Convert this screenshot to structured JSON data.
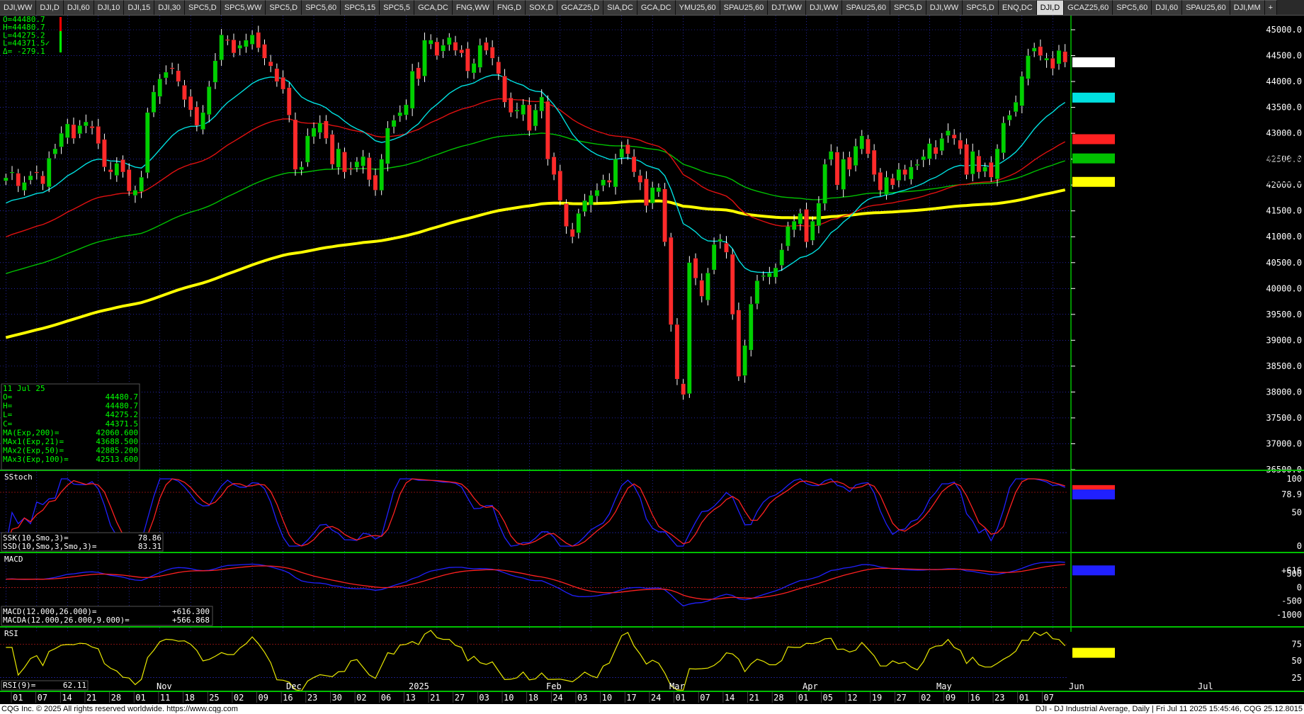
{
  "tabs": [
    "DJI,WW",
    "DJI,D",
    "DJI,60",
    "DJI,10",
    "DJI,15",
    "DJI,30",
    "SPC5,D",
    "SPC5,WW",
    "SPC5,D",
    "SPC5,60",
    "SPC5,15",
    "SPC5,5",
    "GCA,DC",
    "FNG,WW",
    "FNG,D",
    "SOX,D",
    "GCAZ25,D",
    "SIA,DC",
    "GCA,DC",
    "YMU25,60",
    "SPAU25,60",
    "DJT,WW",
    "DJI,WW",
    "SPAU25,60",
    "SPC5,D",
    "DJI,WW",
    "SPC5,D",
    "ENQ,DC",
    "DJI,D",
    "GCAZ25,60",
    "SPC5,60",
    "DJI,60",
    "SPAU25,60",
    "DJI,MM",
    "+"
  ],
  "active_tab_index": 28,
  "ohlc_top": {
    "o": "O=44480.7",
    "h": "H=44480.7",
    "l": "L=44275.2",
    "c": "L=44371.5✓",
    "d": "Δ= -279.1"
  },
  "cursor_box": {
    "date": "11 Jul 25",
    "rows": [
      {
        "label": "O=",
        "value": "44480.7"
      },
      {
        "label": "H=",
        "value": "44480.7"
      },
      {
        "label": "L=",
        "value": "44275.2"
      },
      {
        "label": "C=",
        "value": "44371.5"
      },
      {
        "label": "MA(Exp,200)=",
        "value": "42060.600"
      },
      {
        "label": "MAx1(Exp,21)=",
        "value": "43688.500"
      },
      {
        "label": "MAx2(Exp,50)=",
        "value": "42885.200"
      },
      {
        "label": "MAx3(Exp,100)=",
        "value": "42513.600"
      }
    ]
  },
  "price_axis": {
    "labels": [
      "45000.0",
      "44500.0",
      "44000.0",
      "43500.0",
      "43000.0",
      "42500.0",
      "42000.0",
      "41500.0",
      "41000.0",
      "40500.0",
      "40000.0",
      "39500.0",
      "39000.0",
      "38500.0",
      "38000.0",
      "37500.0",
      "37000.0",
      "36500.0"
    ]
  },
  "price_tags": [
    {
      "value": "44371.5",
      "price": 44371.5,
      "bg": "#ffffff",
      "fg": "#000000"
    },
    {
      "value": "43688.5",
      "price": 43688.5,
      "bg": "#00e0e0",
      "fg": "#000000"
    },
    {
      "value": "42885.2",
      "price": 42885.2,
      "bg": "#ff2020",
      "fg": "#000000"
    },
    {
      "value": "42513.6",
      "price": 42513.6,
      "bg": "#00c000",
      "fg": "#000000"
    },
    {
      "value": "42060.6",
      "price": 42060.6,
      "bg": "#ffff00",
      "fg": "#000000"
    }
  ],
  "stoch": {
    "title": "SStoch",
    "axis": [
      "100",
      "50",
      "0"
    ],
    "k_label": "SSK(10,Smo,3)=",
    "k_value": "78.86",
    "d_label": "SSD(10,Smo,3,Smo,3)=",
    "d_value": "83.31",
    "tag1": "83.3",
    "tag2": "78.9"
  },
  "macd": {
    "title": "MACD",
    "axis": [
      "500",
      "0",
      "-500",
      "-1000"
    ],
    "tag": "+616",
    "l1": "MACD(12.000,26.000)=",
    "v1": "+616.300",
    "l2": "MACDA(12.000,26.000,9.000)=",
    "v2": "+566.868"
  },
  "rsi": {
    "title": "RSI",
    "axis": [
      "75",
      "50",
      "25"
    ],
    "tag": "62.11",
    "label": "RSI(9)=",
    "value": "62.11"
  },
  "date_axis": [
    "01",
    "07",
    "14",
    "21",
    "28",
    "01",
    "11",
    "18",
    "25",
    "02",
    "09",
    "16",
    "23",
    "30",
    "02",
    "06",
    "13",
    "21",
    "27",
    "03",
    "10",
    "18",
    "24",
    "03",
    "10",
    "17",
    "24",
    "01",
    "07",
    "14",
    "21",
    "28",
    "01",
    "05",
    "12",
    "19",
    "27",
    "02",
    "09",
    "16",
    "23",
    "01",
    "07"
  ],
  "month_labels": [
    "Nov",
    "Dec",
    "2025",
    "Feb",
    "Mar",
    "Apr",
    "May",
    "Jun",
    "Jul"
  ],
  "footer": {
    "left": "CQG Inc. © 2025 All rights reserved worldwide. https://www.cqg.com",
    "right": "DJI - DJ Industrial Average, Daily | Fri Jul 11 2025 15:45:46, CQG 25.12.8015"
  },
  "colors": {
    "up": "#00d000",
    "down": "#ff2a2a",
    "ma21": "#00e0e0",
    "ma50": "#e01010",
    "ma100": "#00c000",
    "ma200": "#ffff00",
    "stochK": "#2020ff",
    "stochD": "#ff2020",
    "rsi": "#e8e800",
    "grid": "#3a3aff"
  },
  "chart_data": {
    "type": "candlestick",
    "symbol": "DJI - DJ Industrial Average, Daily",
    "y_range": [
      36500,
      45000
    ],
    "closes": [
      42140,
      42250,
      41980,
      42050,
      42180,
      42240,
      42020,
      42520,
      42700,
      43000,
      43180,
      42900,
      43150,
      43220,
      43100,
      42800,
      42350,
      42250,
      42420,
      42250,
      41880,
      41900,
      42150,
      43400,
      43800,
      44050,
      44180,
      44250,
      44000,
      43650,
      43450,
      43150,
      43400,
      43900,
      44400,
      44900,
      44800,
      44550,
      44700,
      44800,
      44900,
      44650,
      44450,
      44300,
      44000,
      43850,
      43350,
      42300,
      42350,
      42950,
      43100,
      43200,
      42900,
      42400,
      42700,
      42250,
      42300,
      42450,
      42550,
      42100,
      41900,
      42500,
      43100,
      43250,
      43400,
      43550,
      44200,
      44050,
      44800,
      44800,
      44500,
      44700,
      44850,
      44600,
      44550,
      44200,
      44350,
      44700,
      44600,
      44450,
      44150,
      43600,
      43400,
      43450,
      43550,
      43050,
      43450,
      43700,
      42500,
      42200,
      41700,
      41200,
      41000,
      41450,
      41700,
      41800,
      41900,
      42100,
      42050,
      42500,
      42700,
      42600,
      42250,
      42050,
      41600,
      41950,
      41950,
      40900,
      39300,
      38250,
      37950,
      40500,
      40200,
      39850,
      40300,
      40850,
      40950,
      40700,
      39500,
      38300,
      38900,
      39700,
      40150,
      40250,
      40300,
      40400,
      40750,
      41200,
      41300,
      41450,
      40900,
      41300,
      41650,
      42400,
      42650,
      42000,
      42500,
      42300,
      42750,
      42950,
      42600,
      42200,
      41900,
      42150,
      42000,
      42300,
      42200,
      42350,
      42400,
      42550,
      42800,
      42600,
      42900,
      43050,
      42900,
      42700,
      42200,
      42650,
      42250,
      42350,
      42150,
      42700,
      43200,
      43350,
      43600,
      44100,
      44500,
      44650,
      44500,
      44450,
      44250,
      44600,
      44371.5
    ],
    "ma21_last": 43688.5,
    "ma50_last": 42885.2,
    "ma100_last": 42513.6,
    "ma200_last": 42060.6
  }
}
